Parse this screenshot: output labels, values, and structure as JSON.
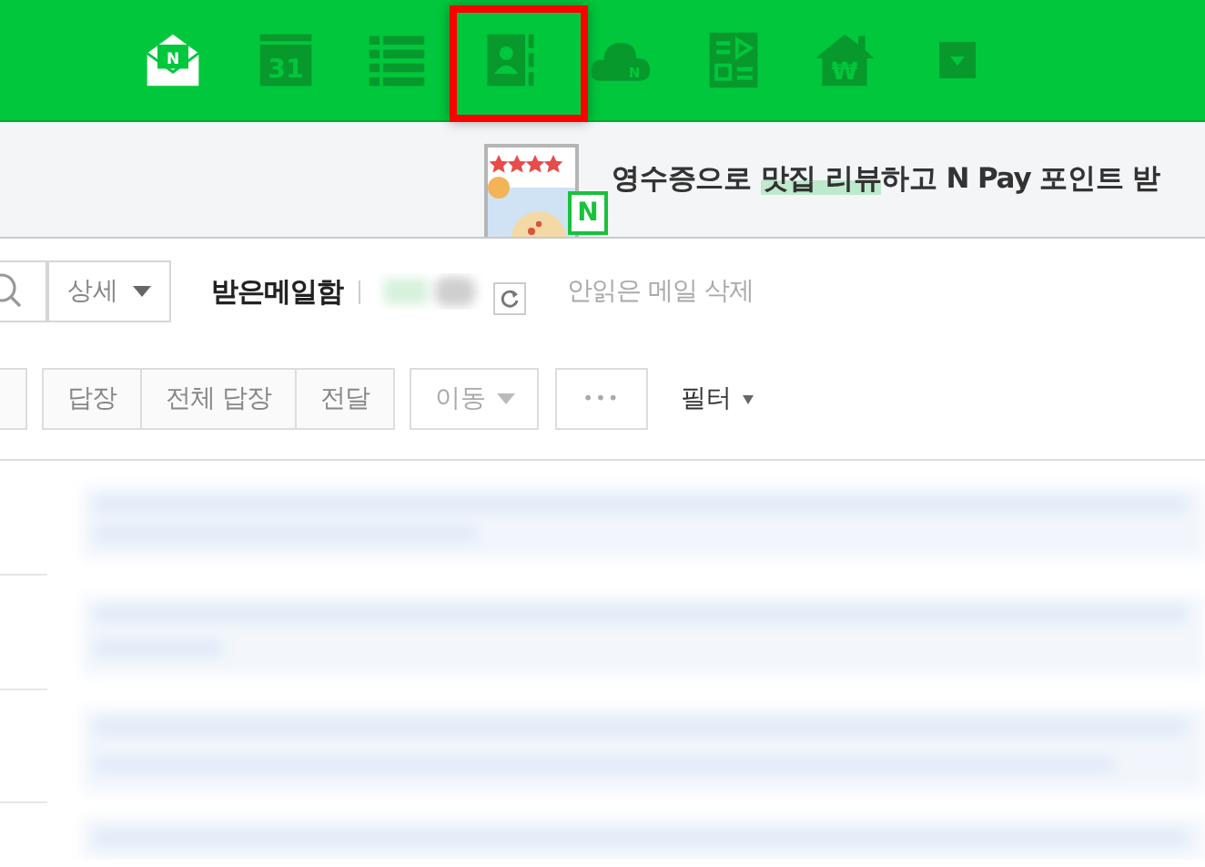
{
  "app_bar": {
    "items": [
      {
        "kind": "mail",
        "glyph": "N",
        "selected": true,
        "highlighted": false
      },
      {
        "kind": "calendar",
        "glyph": "31",
        "selected": false,
        "highlighted": false
      },
      {
        "kind": "list",
        "selected": false,
        "highlighted": false
      },
      {
        "kind": "contacts",
        "selected": false,
        "highlighted": true
      },
      {
        "kind": "cloud",
        "glyph": "N",
        "selected": false,
        "highlighted": false
      },
      {
        "kind": "memo",
        "selected": false,
        "highlighted": false
      },
      {
        "kind": "household",
        "glyph": "₩",
        "selected": false,
        "highlighted": false
      },
      {
        "kind": "more",
        "selected": false,
        "highlighted": false
      }
    ]
  },
  "banner": {
    "text_before": "영수증으로 ",
    "highlight": "맛집 리뷰",
    "text_after": "하고 N Pay 포인트 받",
    "badge": "N"
  },
  "toolbar": {
    "detail_button": "상세",
    "mailbox_title": "받은메일함",
    "delete_unread": "안읽은 메일 삭제"
  },
  "actions": {
    "reply_group": [
      "답장",
      "전체 답장",
      "전달"
    ],
    "move_button": "이동",
    "more_button": "•••",
    "filter_button": "필터"
  }
}
